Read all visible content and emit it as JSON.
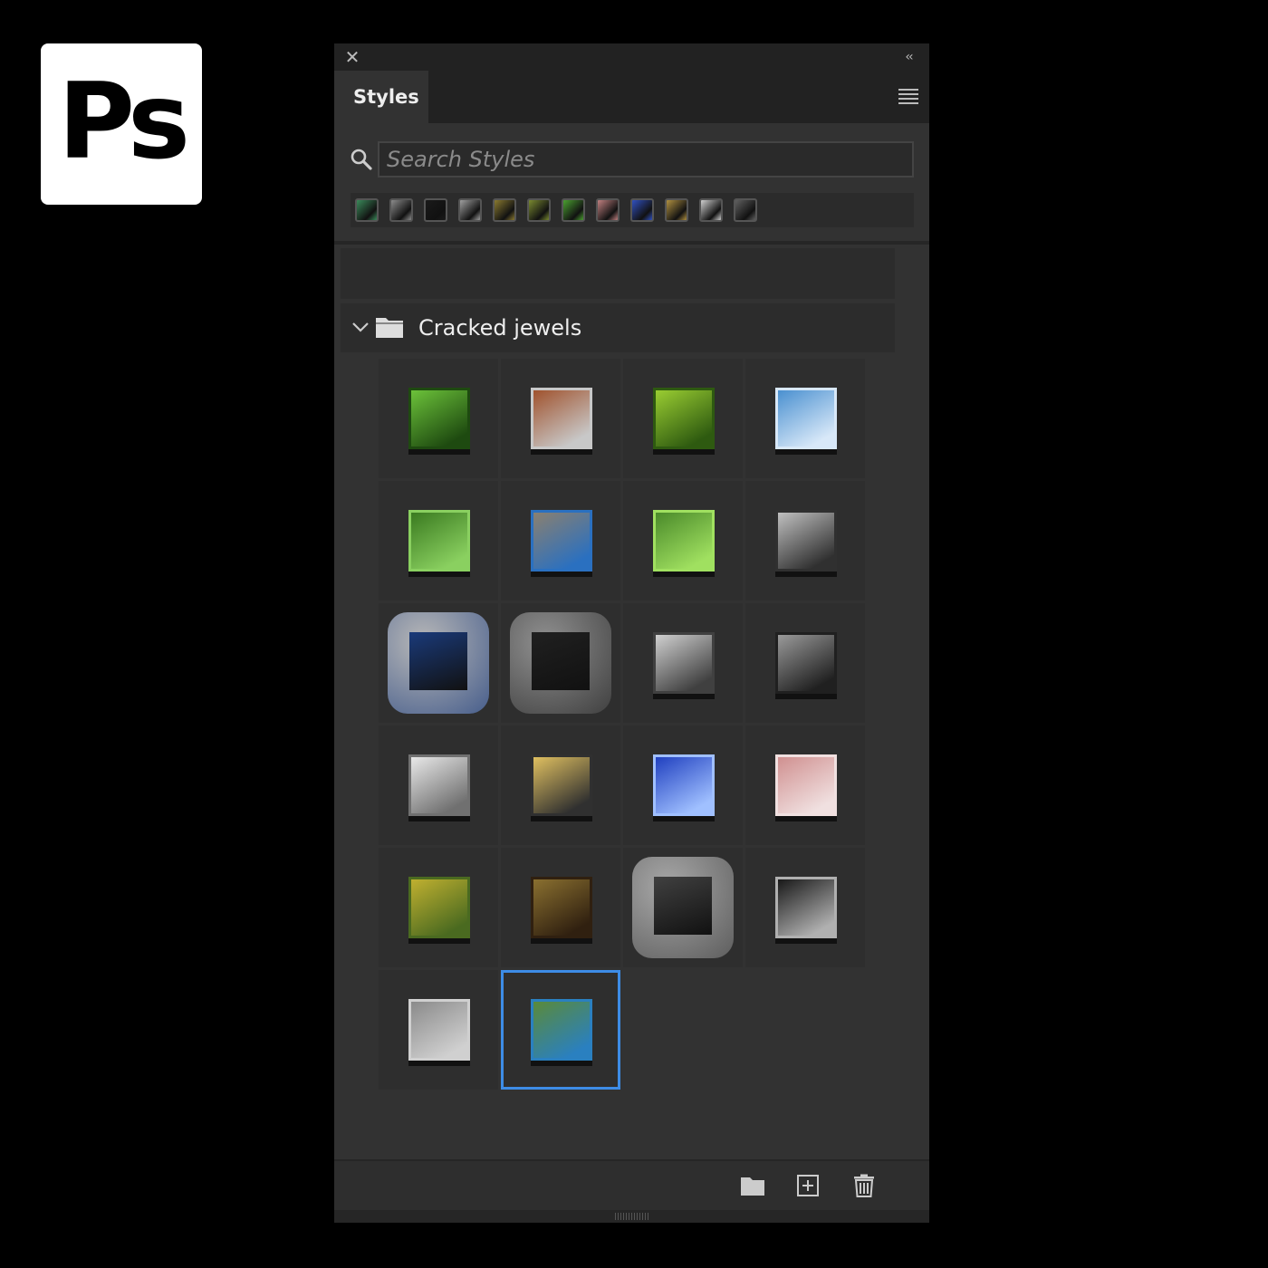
{
  "logo": {
    "text": "Ps"
  },
  "panel": {
    "tab_label": "Styles",
    "search": {
      "placeholder": "Search Styles"
    },
    "group": {
      "label": "Cracked jewels",
      "expanded": true
    },
    "recent_swatches": [
      {
        "icon": "green-blue-swatch",
        "color": "#3a8a5a"
      },
      {
        "icon": "gray-swatch",
        "color": "#8c8c8c"
      },
      {
        "icon": "black-swatch",
        "color": "#1a1a1a"
      },
      {
        "icon": "silver-frame-swatch",
        "color": "#a0a0a0"
      },
      {
        "icon": "gold-swatch",
        "color": "#8a7a30"
      },
      {
        "icon": "olive-swatch",
        "color": "#7a8a30"
      },
      {
        "icon": "green-swatch",
        "color": "#4aa030"
      },
      {
        "icon": "pink-swatch",
        "color": "#c08080"
      },
      {
        "icon": "blue-swatch",
        "color": "#3050c0"
      },
      {
        "icon": "gold-black-swatch",
        "color": "#b09040"
      },
      {
        "icon": "white-swatch",
        "color": "#d0d0d0"
      },
      {
        "icon": "dark-gray-swatch",
        "color": "#606060"
      }
    ],
    "styles": [
      {
        "icon": "green-glossy-style",
        "color": "#6cc23a",
        "accent": "#1e4a10",
        "rounded": false
      },
      {
        "icon": "rust-bevel-style",
        "color": "#a0522d",
        "accent": "#c8c8c8",
        "rounded": false
      },
      {
        "icon": "lime-cracked-style",
        "color": "#9acd32",
        "accent": "#2e5a10",
        "rounded": false
      },
      {
        "icon": "blue-ice-style",
        "color": "#4a90d0",
        "accent": "#d8e8f8",
        "rounded": false
      },
      {
        "icon": "moss-green-style",
        "color": "#3a7a20",
        "accent": "#8ad060",
        "rounded": false
      },
      {
        "icon": "stone-blue-style",
        "color": "#8a8070",
        "accent": "#2a70c0",
        "rounded": false
      },
      {
        "icon": "grass-green-style",
        "color": "#4a8a2a",
        "accent": "#a0e060",
        "rounded": false
      },
      {
        "icon": "silver-chrome-style",
        "color": "#c0c0c0",
        "accent": "#303030",
        "rounded": false
      },
      {
        "icon": "blue-pearls-stone-style",
        "color": "#b8b8b8",
        "accent": "#1a3a7a",
        "rounded": true
      },
      {
        "icon": "diamond-frame-style",
        "color": "#909090",
        "accent": "#202020",
        "rounded": true
      },
      {
        "icon": "mesh-silver-style",
        "color": "#d0d0d0",
        "accent": "#404040",
        "rounded": false
      },
      {
        "icon": "gray-smoke-style",
        "color": "#9a9a9a",
        "accent": "#202020",
        "rounded": false
      },
      {
        "icon": "white-marble-style",
        "color": "#e8e8e8",
        "accent": "#707070",
        "rounded": false
      },
      {
        "icon": "gold-jewel-style",
        "color": "#e0c060",
        "accent": "#303030",
        "rounded": false
      },
      {
        "icon": "cobalt-blue-style",
        "color": "#2040c0",
        "accent": "#a0c0ff",
        "rounded": false
      },
      {
        "icon": "pink-stucco-style",
        "color": "#d09090",
        "accent": "#f0e0e0",
        "rounded": false
      },
      {
        "icon": "gold-green-style",
        "color": "#c0b030",
        "accent": "#4a6a20",
        "rounded": false
      },
      {
        "icon": "bronze-glitter-style",
        "color": "#8a7030",
        "accent": "#302010",
        "rounded": false
      },
      {
        "icon": "cracked-stone-style",
        "color": "#a8a8a8",
        "accent": "#404040",
        "rounded": true
      },
      {
        "icon": "black-chrome-style",
        "color": "#181818",
        "accent": "#b0b0b0",
        "rounded": false
      },
      {
        "icon": "gray-granite-style",
        "color": "#8a8a8a",
        "accent": "#d0d0d0",
        "rounded": false
      },
      {
        "icon": "green-blue-rock-style",
        "color": "#5a8a3a",
        "accent": "#2a80c0",
        "rounded": false,
        "selected": true
      }
    ],
    "footer": {
      "new_group_icon": "folder-icon",
      "new_style_icon": "plus-square-icon",
      "delete_icon": "trash-icon"
    }
  }
}
